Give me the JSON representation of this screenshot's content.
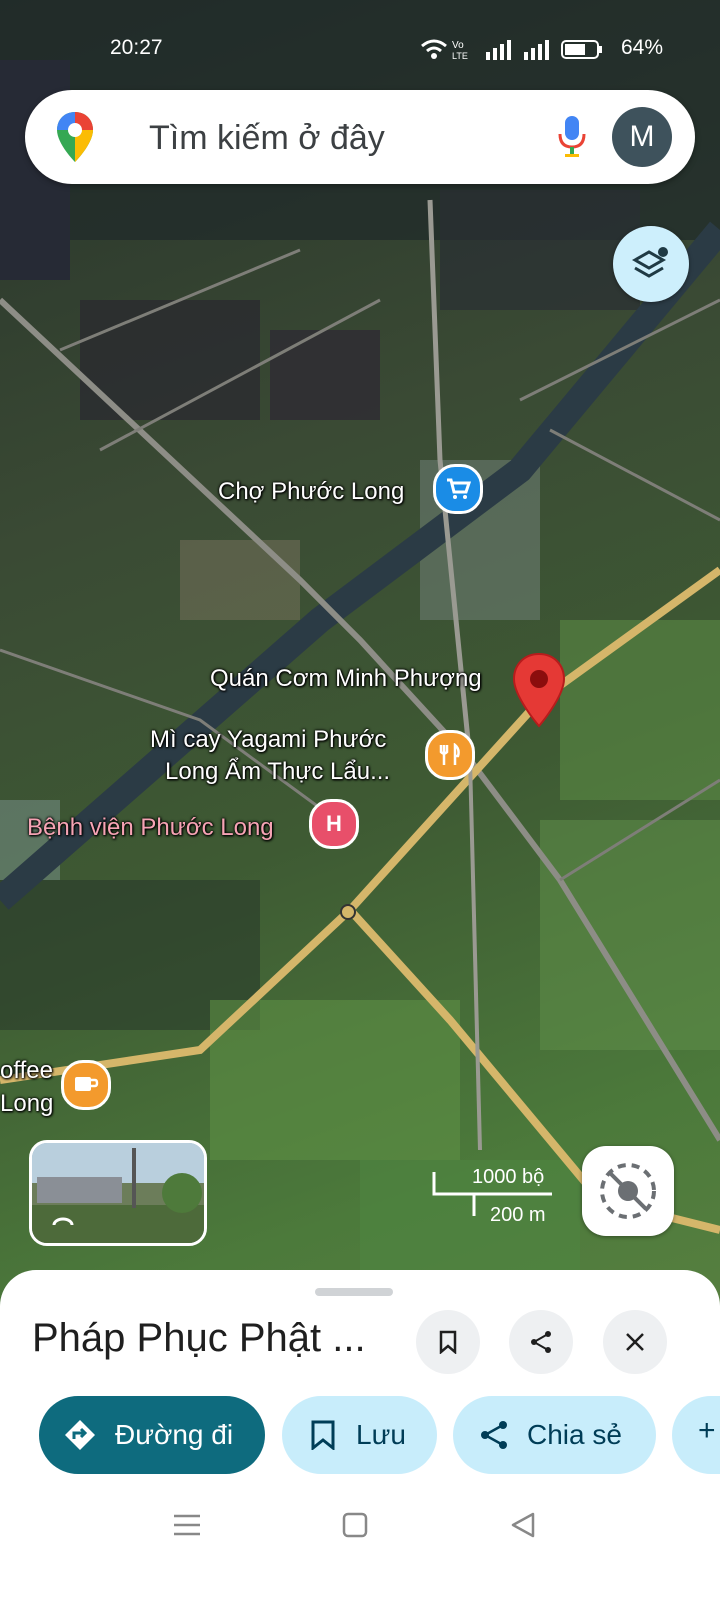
{
  "status_bar": {
    "time": "20:27",
    "network": "VoLTE",
    "battery_percent": "64%"
  },
  "search": {
    "placeholder": "Tìm kiếm ở đây",
    "avatar_letter": "M"
  },
  "map": {
    "labels": {
      "market": "Chợ Phước Long",
      "restaurant": "Quán Cơm Minh Phượng",
      "noodle_line1": "Mì cay Yagami Phước",
      "noodle_line2": "Long Ẩm Thực Lẩu...",
      "hospital": "Bệnh viện Phước Long",
      "coffee_line1": "offee",
      "coffee_line2": "Long"
    },
    "hospital_marker": "H",
    "scale": {
      "feet": "1000 bộ",
      "meters": "200 m"
    }
  },
  "place_sheet": {
    "title": "Pháp Phục Phật ...",
    "actions": {
      "directions": "Đường đi",
      "save": "Lưu",
      "share": "Chia sẻ"
    }
  },
  "colors": {
    "primary": "#0e6b7e",
    "chip": "#c8edfb",
    "pin_red": "#e53935",
    "poi_blue": "#1a8ce6",
    "poi_orange": "#f39a2d",
    "poi_hospital": "#e84f6a"
  }
}
